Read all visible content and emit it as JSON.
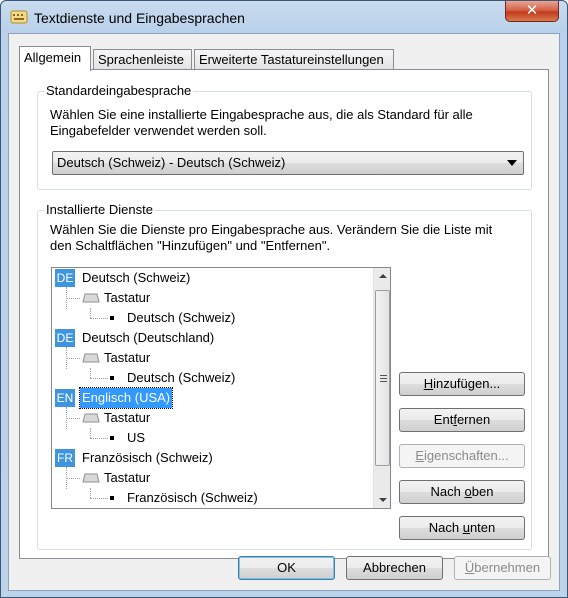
{
  "window": {
    "title": "Textdienste und Eingabesprachen",
    "close_label": "✕"
  },
  "tabs": [
    {
      "label": "Allgemein",
      "active": true
    },
    {
      "label": "Sprachenleiste",
      "active": false
    },
    {
      "label": "Erweiterte Tastatureinstellungen",
      "active": false
    }
  ],
  "default_language": {
    "title": "Standardeingabesprache",
    "description_line1": "Wählen Sie eine installierte Eingabesprache aus, die als Standard für alle",
    "description_line2": "Eingabefelder verwendet werden soll.",
    "selected": "Deutsch (Schweiz) - Deutsch (Schweiz)"
  },
  "installed_services": {
    "title": "Installierte Dienste",
    "description_line1": "Wählen Sie die Dienste pro Eingabesprache aus. Verändern Sie die Liste mit",
    "description_line2": "den Schaltflächen \"Hinzufügen\" und \"Entfernen\".",
    "languages": [
      {
        "badge": "DE",
        "name": "Deutsch (Schweiz)",
        "category": "Tastatur",
        "layout": "Deutsch (Schweiz)"
      },
      {
        "badge": "DE",
        "name": "Deutsch (Deutschland)",
        "category": "Tastatur",
        "layout": "Deutsch (Schweiz)"
      },
      {
        "badge": "EN",
        "name": "Englisch (USA)",
        "category": "Tastatur",
        "layout": "US"
      },
      {
        "badge": "FR",
        "name": "Französisch (Schweiz)",
        "category": "Tastatur",
        "layout": "Französisch (Schweiz)"
      }
    ],
    "buttons": {
      "add": {
        "pre": "",
        "ul": "H",
        "post": "inzufügen..."
      },
      "remove": {
        "pre": "Ent",
        "ul": "f",
        "post": "ernen"
      },
      "properties": {
        "pre": "",
        "ul": "E",
        "post": "igenschaften..."
      },
      "up": {
        "pre": "Nach ",
        "ul": "o",
        "post": "ben"
      },
      "down": {
        "pre": "Nach ",
        "ul": "u",
        "post": "nten"
      }
    }
  },
  "footer": {
    "ok": "OK",
    "cancel": "Abbrechen",
    "apply": {
      "pre": "",
      "ul": "Ü",
      "post": "bernehmen"
    }
  },
  "colors": {
    "badge": "#3d95e0",
    "selection": "#3399ff",
    "close_button": "#c23b1c"
  }
}
